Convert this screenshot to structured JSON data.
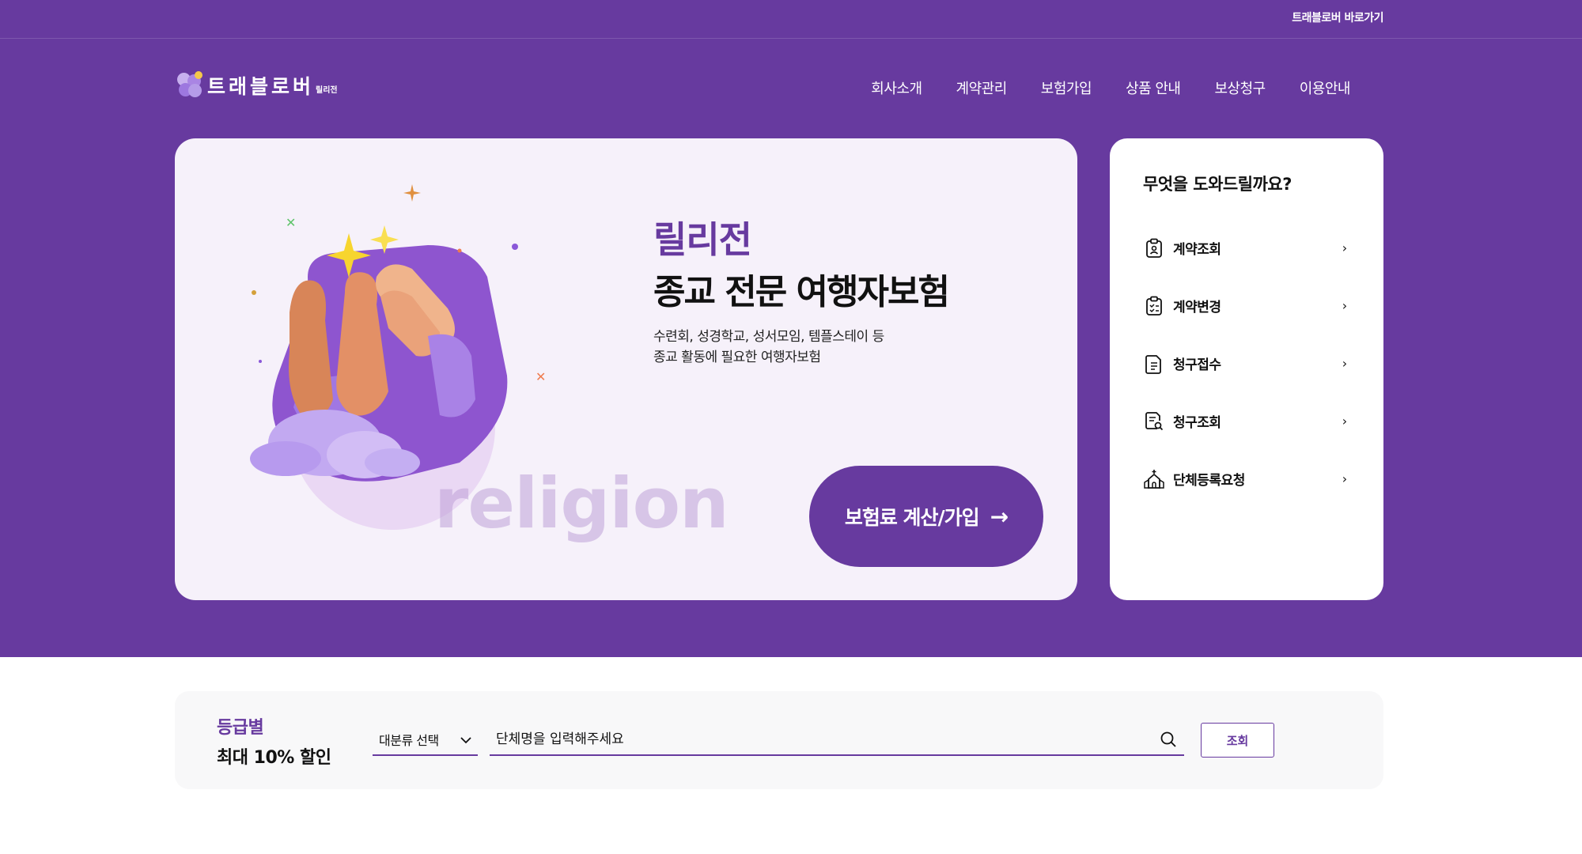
{
  "topbar": {
    "shortcut_label": "트래블로버 바로가기"
  },
  "logo": {
    "brand": "트래블로버",
    "sub": "릴리전"
  },
  "nav": {
    "items": [
      {
        "label": "회사소개"
      },
      {
        "label": "계약관리"
      },
      {
        "label": "보험가입"
      },
      {
        "label": "상품 안내"
      },
      {
        "label": "보상청구"
      },
      {
        "label": "이용안내"
      }
    ]
  },
  "banner": {
    "eyebrow": "릴리전",
    "title": "종교 전문 여행자보험",
    "desc_line1": "수련회, 성경학교, 성서모임, 템플스테이 등",
    "desc_line2": "종교 활동에 필요한 여행자보험",
    "watermark": "religion",
    "cta_label": "보험료 계산/가입",
    "cta_arrow": "→"
  },
  "help": {
    "title": "무엇을 도와드릴까요?",
    "items": [
      {
        "label": "계약조회",
        "icon": "contract-search-icon"
      },
      {
        "label": "계약변경",
        "icon": "contract-edit-icon"
      },
      {
        "label": "청구접수",
        "icon": "claim-document-icon"
      },
      {
        "label": "청구조회",
        "icon": "claim-search-icon"
      },
      {
        "label": "단체등록요청",
        "icon": "church-icon"
      }
    ]
  },
  "search": {
    "grade_line1": "등급별",
    "grade_line2": "최대 10% 할인",
    "category_selected": "대분류 선택",
    "input_placeholder": "단체명을 입력해주세요",
    "submit_label": "조회"
  },
  "colors": {
    "brand_purple": "#673a9f",
    "banner_bg": "#f6f1fa"
  }
}
